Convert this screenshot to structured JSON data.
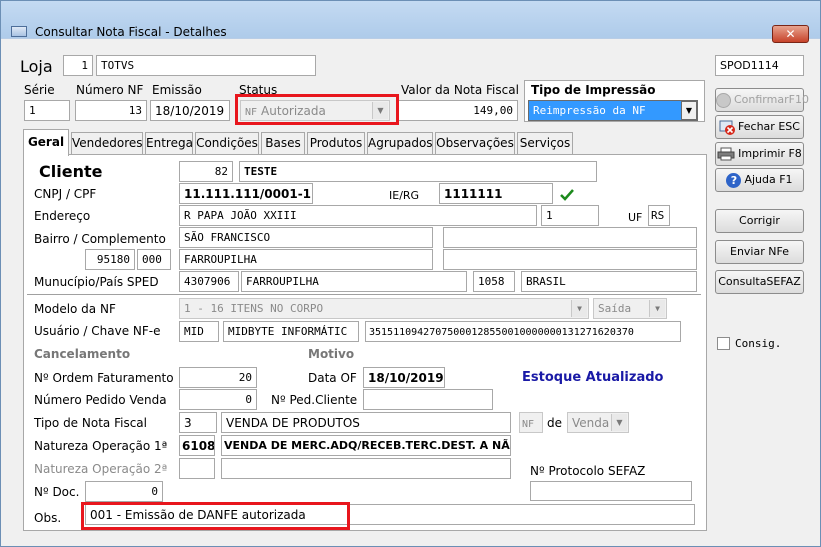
{
  "window": {
    "title": "Consultar Nota Fiscal - Detalhes",
    "close": "✕"
  },
  "loja": {
    "label": "Loja",
    "number": "1",
    "name": "TOTVS"
  },
  "program_code": "SPOD1114",
  "header": {
    "serie_label": "Série",
    "serie": "1",
    "numero_label": "Número NF",
    "numero": "13",
    "emissao_label": "Emissão",
    "emissao": "18/10/2019",
    "status_label": "Status",
    "status_prefix": "NF",
    "status": "Autorizada",
    "valor_label": "Valor da Nota Fiscal",
    "valor": "149,00",
    "tipo_impressao_label": "Tipo de Impressão",
    "tipo_impressao": "Reimpressão da  NF"
  },
  "tabs": [
    "Geral",
    "Vendedores",
    "Entrega",
    "Condições",
    "Bases",
    "Produtos",
    "Agrupados",
    "Observações",
    "Serviços"
  ],
  "cliente": {
    "label": "Cliente",
    "codigo": "82",
    "nome": "TESTE",
    "cnpj_label": "CNPJ / CPF",
    "cnpj": "11.111.111/0001-11",
    "ie_label": "IE/RG",
    "ie": "1111111",
    "endereco_label": "Endereço",
    "endereco": "R PAPA JOÃO XXIII",
    "numero": "1",
    "uf_label": "UF",
    "uf": "RS",
    "bairro_label": "Bairro / Complemento",
    "bairro": "SÃO FRANCISCO",
    "complemento": "",
    "cep": "95180",
    "cep2": "000",
    "cidade": "FARROUPILHA",
    "municipio_label": "Munucípio/País SPED",
    "municipio_cod": "4307906",
    "municipio": "FARROUPILHA",
    "pais_cod": "1058",
    "pais": "BRASIL"
  },
  "nf": {
    "modelo_label": "Modelo da NF",
    "modelo": "1 - 16 ITENS NO CORPO",
    "modelo_tipo": "Saída",
    "usuario_label": "Usuário / Chave NF-e",
    "usuario": "MID",
    "usuario_nome": "MIDBYTE INFORMÁTIC",
    "chave": "35151109427075000128550010000000131271620370",
    "cancelamento_label": "Cancelamento",
    "motivo_label": "Motivo",
    "ordem_label": "Nº Ordem Faturamento",
    "ordem": "20",
    "data_of_label": "Data OF",
    "data_of": "18/10/2019",
    "estoque_status": "Estoque Atualizado",
    "pedido_label": "Número Pedido Venda",
    "pedido": "0",
    "ped_cliente_label": "Nº Ped.Cliente",
    "ped_cliente": "",
    "tipo_label": "Tipo de Nota Fiscal",
    "tipo_cod": "3",
    "tipo": "VENDA DE PRODUTOS",
    "tipo_nf": "NF",
    "tipo_de": "de",
    "tipo_venda": "Venda",
    "natureza1_label": "Natureza Operação 1ª",
    "natureza1_cod": "6108",
    "natureza1": "VENDA DE MERC.ADQ/RECEB.TERC.DEST. A NÃO CON",
    "natureza2_label": "Natureza Operação 2ª",
    "protocolo_label": "Nº Protocolo SEFAZ",
    "protocolo": "",
    "doc_label": "Nº Doc.",
    "doc": "0",
    "obs_label": "Obs.",
    "obs": "001 - Emissão de DANFE autorizada"
  },
  "buttons": {
    "confirmar": "ConfirmarF10",
    "fechar": "Fechar ESC",
    "imprimir": "Imprimir  F8",
    "ajuda": "Ajuda    F1",
    "corrigir": "Corrigir",
    "enviar": "Enviar NFe",
    "consulta": "ConsultaSEFAZ",
    "consig": "Consig."
  },
  "colors": {
    "highlight": "#e8161d",
    "selection": "#3399ff",
    "estoque": "#1a1aa6"
  }
}
